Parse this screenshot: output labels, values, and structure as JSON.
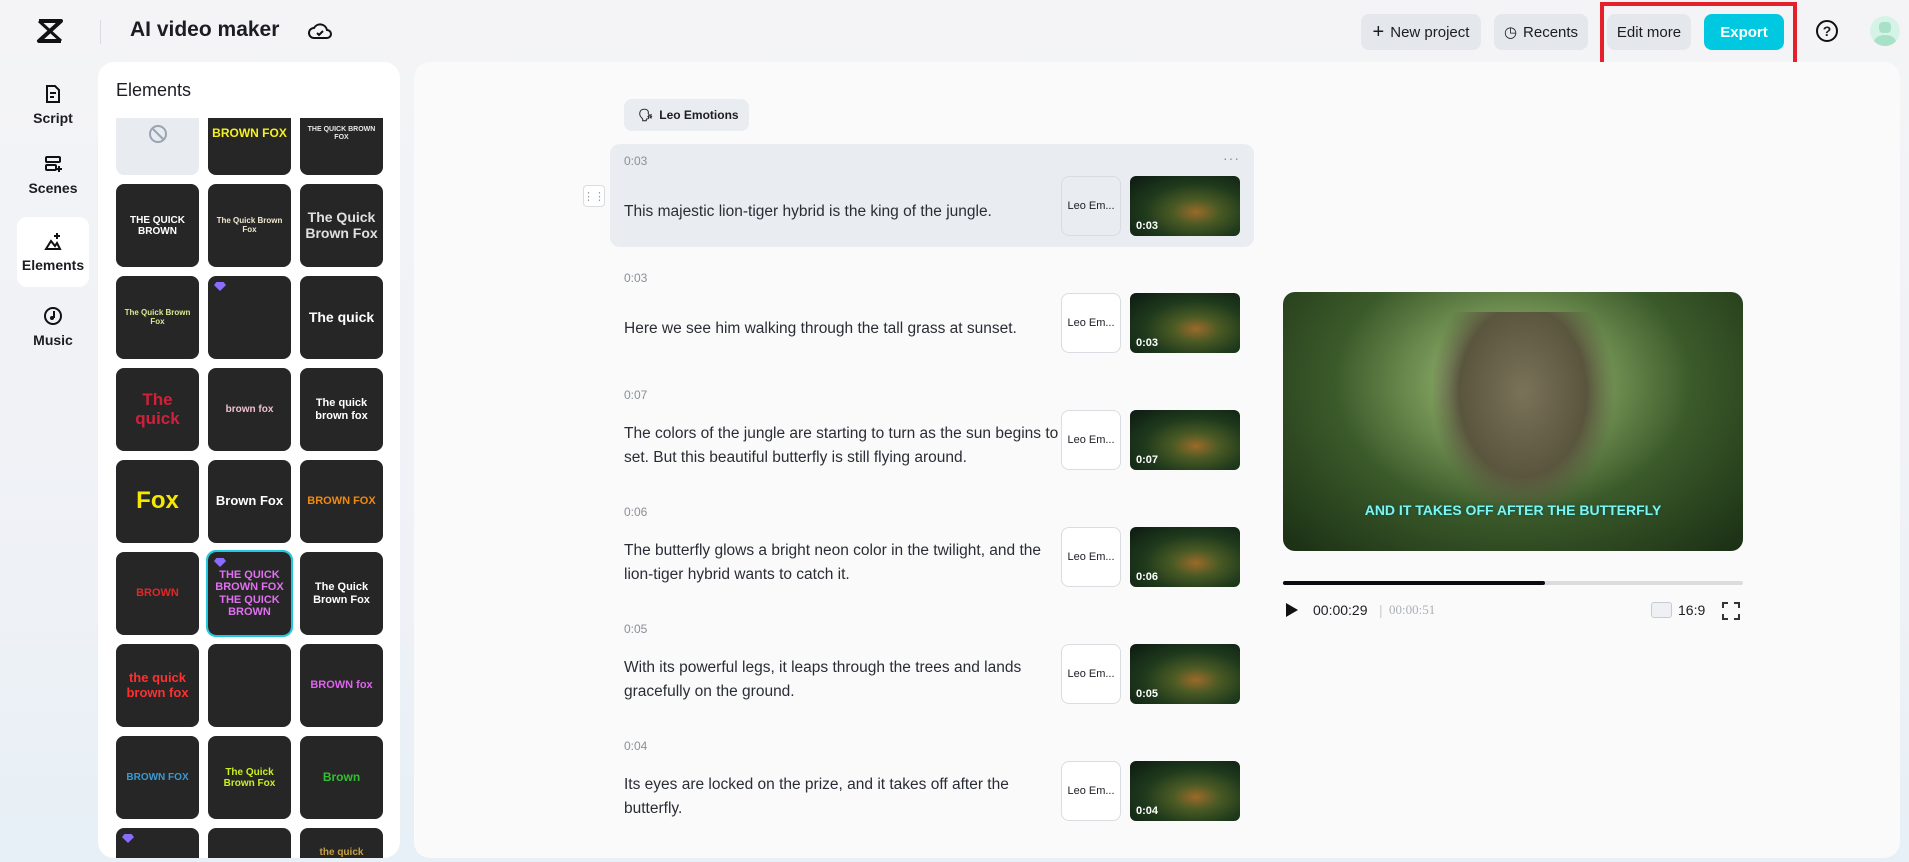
{
  "header": {
    "title": "AI video maker",
    "new_project": "New project",
    "recents": "Recents",
    "edit_more": "Edit more",
    "export": "Export",
    "help": "?"
  },
  "colors": {
    "accent": "#00c8e0",
    "highlight": "#e4202a"
  },
  "rail": [
    {
      "label": "Script",
      "icon": "script-icon"
    },
    {
      "label": "Scenes",
      "icon": "scenes-icon"
    },
    {
      "label": "Elements",
      "icon": "elements-icon"
    },
    {
      "label": "Music",
      "icon": "music-icon"
    }
  ],
  "elements": {
    "title": "Elements",
    "tiles": [
      {
        "text": "",
        "none": true
      },
      {
        "text": "BROWN FOX",
        "color": "#f4f020",
        "size": 12
      },
      {
        "text": "THE QUICK BROWN FOX",
        "color": "#e8e8e8",
        "size": 7
      },
      {
        "text": "THE QUICK BROWN",
        "color": "#ffffff",
        "size": 10
      },
      {
        "text": "The Quick Brown Fox",
        "color": "#f0e8d0",
        "size": 8
      },
      {
        "text": "The Quick Brown Fox",
        "color": "#e0e0e0",
        "size": 14
      },
      {
        "text": "The Quick Brown Fox",
        "color": "#d8e890",
        "size": 8
      },
      {
        "text": "",
        "gem": true
      },
      {
        "text": "The quick",
        "color": "#ffffff",
        "size": 14
      },
      {
        "text": "The quick",
        "color": "#d0203a",
        "size": 17
      },
      {
        "text": "brown fox",
        "color": "#f0c0d0",
        "size": 10
      },
      {
        "text": "The quick brown fox",
        "color": "#ffffff",
        "size": 11
      },
      {
        "text": "Fox",
        "color": "#f4e800",
        "size": 24
      },
      {
        "text": "Brown Fox",
        "color": "#ffffff",
        "size": 13
      },
      {
        "text": "BROWN FOX",
        "color": "#f08a10",
        "size": 11
      },
      {
        "text": "BROWN",
        "color": "#e02828",
        "size": 11
      },
      {
        "text": "THE QUICK BROWN FOX THE QUICK BROWN",
        "color": "#e070f0",
        "size": 11,
        "gem": true,
        "sel": true
      },
      {
        "text": "The Quick Brown Fox",
        "color": "#ffffff",
        "size": 11
      },
      {
        "text": "the quick brown fox",
        "color": "#ff3030",
        "size": 13
      },
      {
        "text": "",
        "color": "#fff"
      },
      {
        "text": "BROWN fox",
        "color": "#e060f0",
        "size": 11
      },
      {
        "text": "BROWN FOX",
        "color": "#3a9ad0",
        "size": 10
      },
      {
        "text": "The Quick Brown Fox",
        "color": "#c8f020",
        "size": 10
      },
      {
        "text": "Brown",
        "color": "#30c030",
        "size": 12
      },
      {
        "text": "",
        "gem": true
      },
      {
        "text": ""
      },
      {
        "text": "the quick",
        "color": "#c8a040",
        "size": 10
      }
    ]
  },
  "script": {
    "voice_chip": "Leo Emotions",
    "scenes": [
      {
        "time": "0:03",
        "text": "This majestic lion-tiger hybrid is the king of the jungle.",
        "voice": "Leo Em...",
        "duration": "0:03"
      },
      {
        "time": "0:03",
        "text": "Here we see him walking through the tall grass at sunset.",
        "voice": "Leo Em...",
        "duration": "0:03"
      },
      {
        "time": "0:07",
        "text": "The colors of the jungle are starting to turn as the sun begins to set. But this beautiful butterfly is still flying around.",
        "voice": "Leo Em...",
        "duration": "0:07"
      },
      {
        "time": "0:06",
        "text": "The butterfly glows a bright neon color in the twilight, and the lion-tiger hybrid wants to catch it.",
        "voice": "Leo Em...",
        "duration": "0:06"
      },
      {
        "time": "0:05",
        "text": "With its powerful legs, it leaps through the trees and lands gracefully on the ground.",
        "voice": "Leo Em...",
        "duration": "0:05"
      },
      {
        "time": "0:04",
        "text": "Its eyes are locked on the prize, and it takes off after the butterfly.",
        "voice": "Leo Em...",
        "duration": "0:04"
      }
    ]
  },
  "player": {
    "caption": "AND IT TAKES OFF AFTER THE BUTTERFLY",
    "current": "00:00:29",
    "total": "00:00:51",
    "progress": 0.57,
    "aspect": "16:9"
  }
}
